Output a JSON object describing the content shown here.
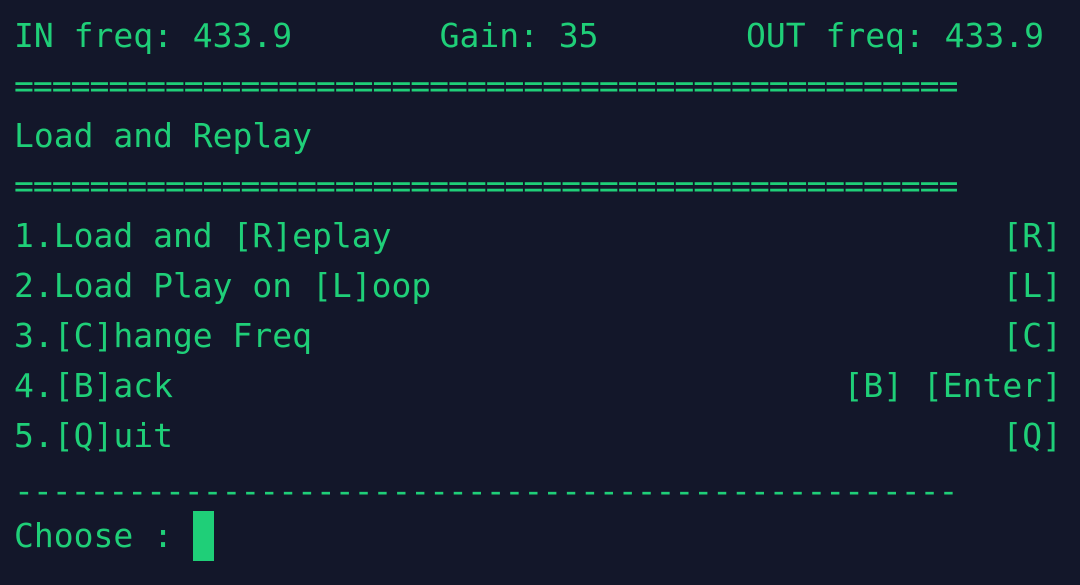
{
  "status": {
    "in_freq": "IN freq: 433.9",
    "gain": "Gain: 35",
    "out_freq": "OUT freq: 433.9"
  },
  "separator_eq": "==================================================",
  "title": "Load and Replay",
  "menu": [
    {
      "label": "1.Load and [R]eplay",
      "key": "[R]"
    },
    {
      "label": "2.Load Play on [L]oop",
      "key": "[L]"
    },
    {
      "label": "3.[C]hange Freq",
      "key": "[C]"
    },
    {
      "label": "4.[B]ack",
      "key": "[B] [Enter]"
    },
    {
      "label": "5.[Q]uit",
      "key": "[Q]"
    }
  ],
  "separator_dash": "--------------------------------------------------",
  "prompt": "Choose :"
}
